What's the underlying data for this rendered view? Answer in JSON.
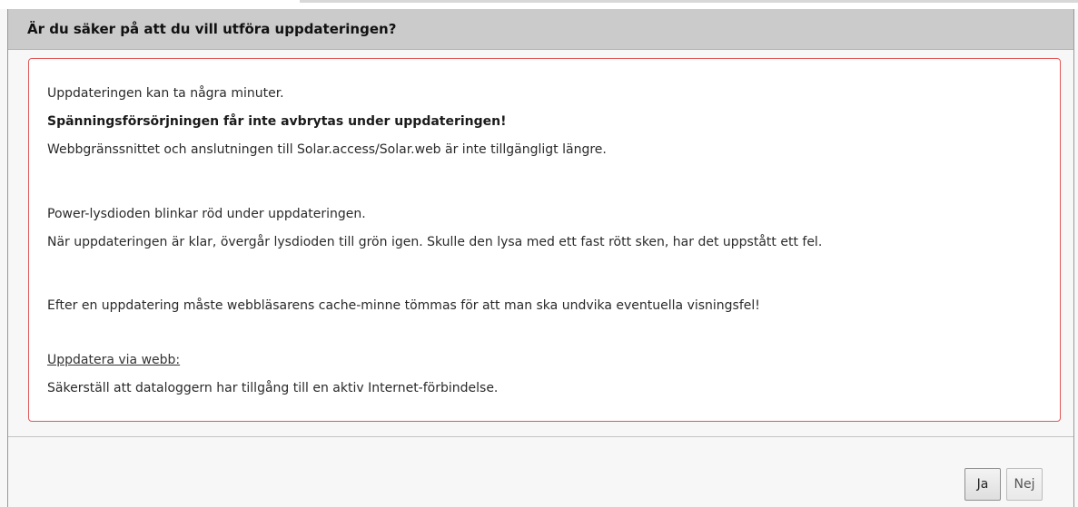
{
  "dialog": {
    "title": "Är du säker på att du vill utföra uppdateringen?",
    "message": {
      "line1": "Uppdateringen kan ta några minuter.",
      "line2_bold": "Spänningsförsörjningen får inte avbrytas under uppdateringen!",
      "line3": "Webbgränssnittet och anslutningen till Solar.access/Solar.web är inte tillgängligt längre.",
      "line4": "Power-lysdioden blinkar röd under uppdateringen.",
      "line5": "När uppdateringen är klar, övergår lysdioden till grön igen. Skulle den lysa med ett fast rött sken, har det uppstått ett fel.",
      "line6": "Efter en uppdatering måste webbläsarens cache-minne tömmas för att man ska undvika eventuella visningsfel!",
      "line7_underlined": "Uppdatera via webb:",
      "line8": "Säkerställ att dataloggern har tillgång till en aktiv Internet-förbindelse."
    },
    "buttons": {
      "yes_label": "Ja",
      "no_label": "Nej"
    }
  },
  "colors": {
    "title_bar": "#cbcbcb",
    "message_border": "#e05858",
    "dialog_background": "#f7f7f7"
  }
}
